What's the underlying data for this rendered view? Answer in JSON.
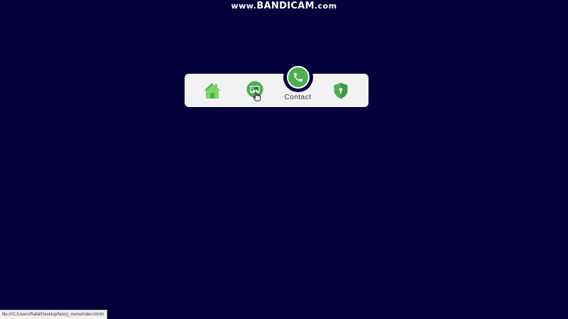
{
  "watermark": {
    "prefix": "www.",
    "brand": "BANDICAM",
    "suffix": ".com"
  },
  "menu": {
    "items": [
      {
        "id": "home",
        "icon": "home-icon",
        "label": ""
      },
      {
        "id": "gallery",
        "icon": "image-icon",
        "label": ""
      },
      {
        "id": "contact",
        "icon": "phone-icon",
        "label": "Contact",
        "active": true
      },
      {
        "id": "security",
        "icon": "shield-lock-icon",
        "label": ""
      }
    ]
  },
  "colors": {
    "background": "#04003a",
    "menu_bg": "#f2f2f4",
    "icon_green": "#4caf50",
    "icon_green_light": "#7cd46a"
  },
  "statusbar": {
    "url": "file:///C:/Users/Rafal/Desktop/fancy_menu/index.html#"
  }
}
